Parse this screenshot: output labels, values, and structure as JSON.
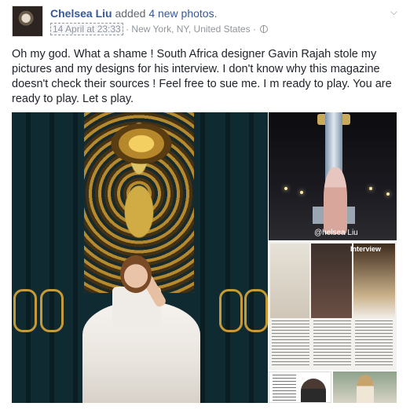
{
  "post": {
    "author": "Chelsea Liu",
    "action_prefix": " added ",
    "action_count": "4 new photos",
    "action_suffix": ".",
    "timestamp": "14 April at 23:33",
    "location": " · New York, NY, United States · ",
    "privacy_icon": "globe-icon",
    "menu_icon": "chevron-down-icon",
    "body": "Oh my god. What a shame ! South Africa designer Gavin Rajah stole my pictures and my designs for his interview. I don't know why this magazine doesn't check their sources ! Feel free to sue me. I m ready to play. You are ready to play. Let s play."
  },
  "photos": {
    "paris_watermark": "@helsea Liu",
    "magazine_heading": "Interview"
  },
  "colors": {
    "link_blue": "#365899",
    "meta_gray": "#90949c",
    "text": "#1d2129"
  }
}
